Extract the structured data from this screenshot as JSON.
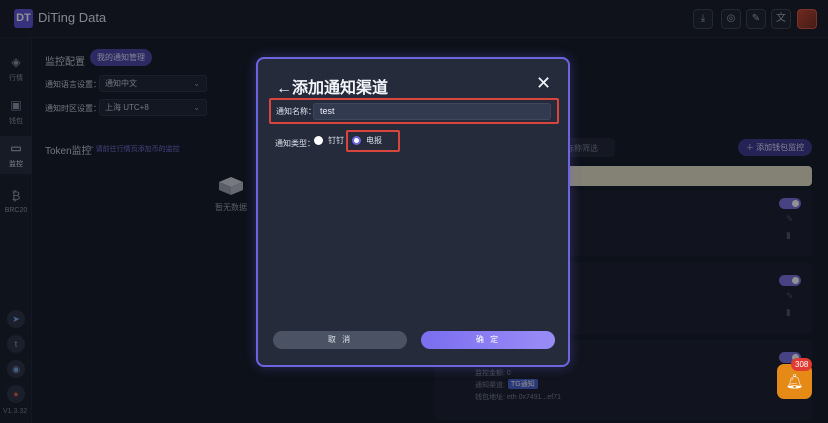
{
  "app": {
    "logo": "DT",
    "title": "DiTing Data"
  },
  "topbar": {
    "icons": [
      "download-icon",
      "wallet-icon",
      "edit-icon",
      "translate-icon"
    ]
  },
  "sidebar": {
    "items": [
      {
        "label": "行情",
        "icon": "layers-icon"
      },
      {
        "label": "钱包",
        "icon": "wallet-icon"
      },
      {
        "label": "监控",
        "icon": "monitor-icon"
      },
      {
        "label": "BRC20",
        "icon": "bitcoin-icon"
      }
    ],
    "socials": [
      "telegram-icon",
      "twitter-icon",
      "discord-icon",
      "weibo-icon"
    ],
    "version": "V1.3.32"
  },
  "page": {
    "section_title": "监控配置",
    "my_notify_btn": "我的通知管理",
    "lang_label": "通知语言设置：",
    "lang_value": "通知中文",
    "tz_label": "通知时区设置：",
    "tz_value": "上海 UTC+8",
    "token_title": "Token监控",
    "token_hint": "* 请前往行情页添加币的监控",
    "empty_text": "暂无数据",
    "filter_text": "标称筛选",
    "add_wallet_btn": "添加钱包监控",
    "card_lines": [
      "监控金额: 0",
      "通知渠道:",
      "TG通知",
      "钱包地址: eth 0x7491...ef71"
    ]
  },
  "modal": {
    "title": "←添加通知渠道",
    "name_label": "通知名称：",
    "name_value": "test",
    "type_label": "通知类型：",
    "options": [
      "钉钉",
      "电报"
    ],
    "selected": "电报",
    "cancel": "取 消",
    "confirm": "确 定"
  },
  "notifications": {
    "count": "308"
  },
  "colors": {
    "accent": "#6d64e0",
    "highlight": "#d8453c",
    "bell": "#e68a17"
  }
}
